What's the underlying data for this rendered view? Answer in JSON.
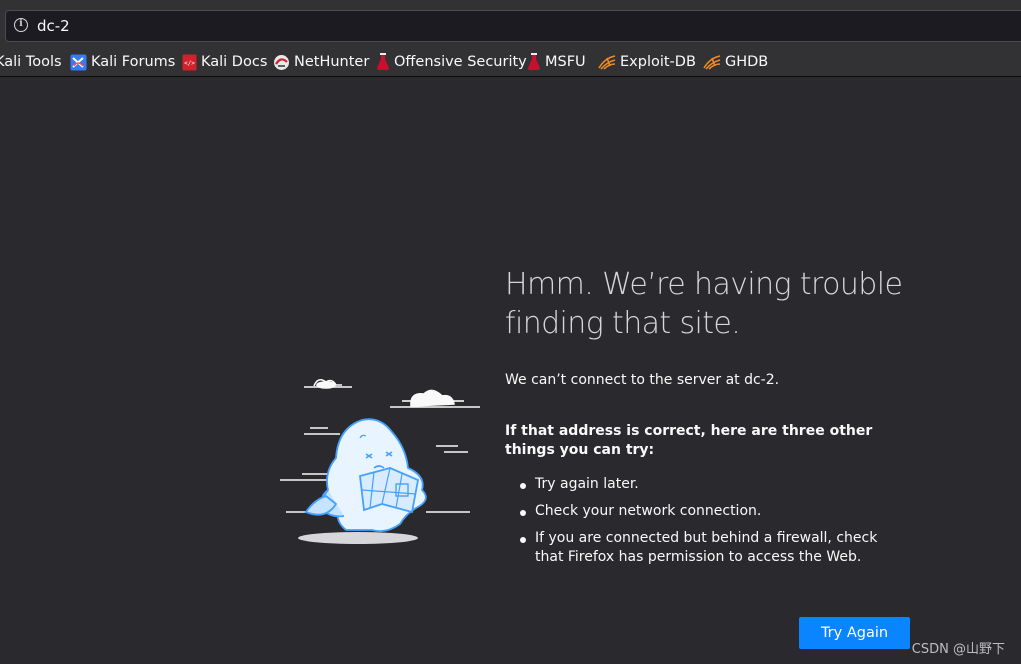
{
  "url_bar": {
    "value": "dc-2",
    "info_icon": "info-icon"
  },
  "bookmarks": [
    {
      "label": "Kali Tools",
      "icon": "kali-tools-icon"
    },
    {
      "label": "Kali Forums",
      "icon": "kali-forums-icon"
    },
    {
      "label": "Kali Docs",
      "icon": "kali-docs-icon"
    },
    {
      "label": "NetHunter",
      "icon": "nethunter-icon"
    },
    {
      "label": "Offensive Security",
      "icon": "offsec-icon"
    },
    {
      "label": "MSFU",
      "icon": "msfu-icon"
    },
    {
      "label": "Exploit-DB",
      "icon": "exploit-db-icon"
    },
    {
      "label": "GHDB",
      "icon": "ghdb-icon"
    }
  ],
  "error_page": {
    "title": "Hmm. We’re having trouble finding that site.",
    "message": "We can’t connect to the server at dc-2.",
    "subheading": "If that address is correct, here are three other things you can try:",
    "tips": [
      "Try again later.",
      "Check your network connection.",
      "If you are connected but behind a firewall, check that Firefox has permission to access the Web."
    ],
    "try_again_label": "Try Again"
  },
  "watermark": "CSDN @山野下",
  "colors": {
    "background": "#2a2a2e",
    "toolbar": "#323234",
    "accent_button": "#0a84ff",
    "illustration_blue": "#45a1ff"
  }
}
